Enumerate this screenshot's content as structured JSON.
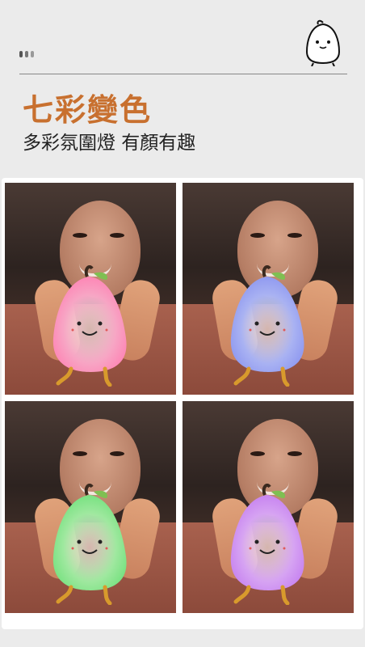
{
  "header": {
    "title": "七彩變色",
    "subtitle": "多彩氛圍燈 有顏有趣"
  },
  "photos": [
    {
      "name": "pink",
      "color": "#f7a5c4",
      "glow": "#ff7fb2"
    },
    {
      "name": "blue",
      "color": "#a9b2f2",
      "glow": "#8a94f0"
    },
    {
      "name": "green",
      "color": "#9fe89f",
      "glow": "#6fe07a"
    },
    {
      "name": "purple",
      "color": "#d6a3f2",
      "glow": "#c47df0"
    }
  ],
  "colors": {
    "accent": "#c8702f",
    "background": "#ebebeb"
  }
}
